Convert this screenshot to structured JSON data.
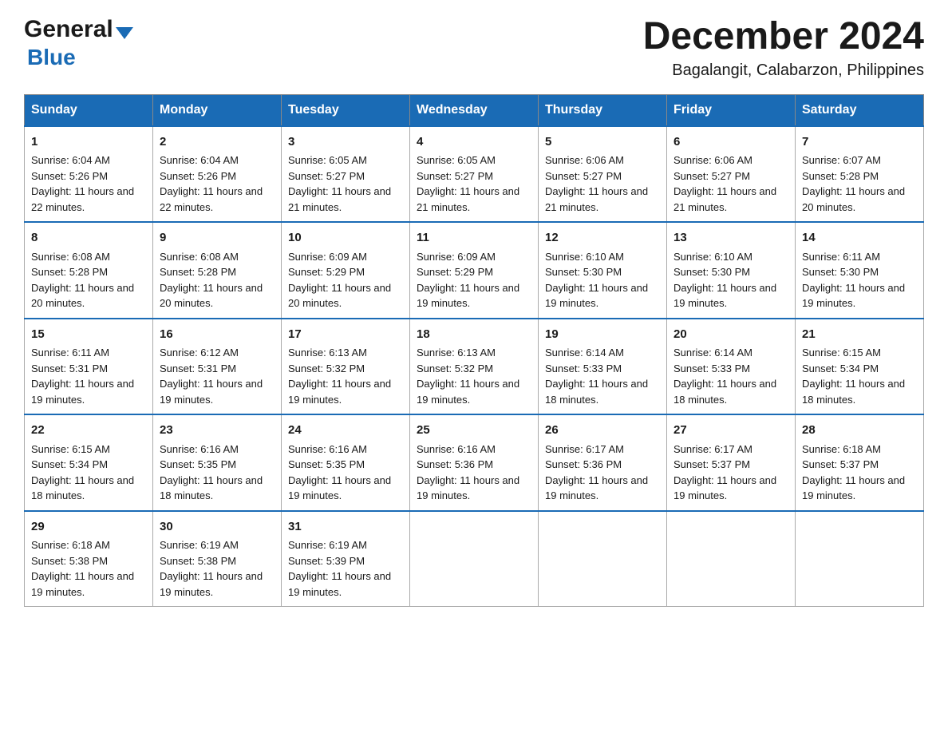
{
  "logo": {
    "general": "General",
    "blue": "Blue",
    "triangle": "▼"
  },
  "title": {
    "month_year": "December 2024",
    "location": "Bagalangit, Calabarzon, Philippines"
  },
  "headers": [
    "Sunday",
    "Monday",
    "Tuesday",
    "Wednesday",
    "Thursday",
    "Friday",
    "Saturday"
  ],
  "weeks": [
    [
      {
        "day": "1",
        "sunrise": "Sunrise: 6:04 AM",
        "sunset": "Sunset: 5:26 PM",
        "daylight": "Daylight: 11 hours and 22 minutes."
      },
      {
        "day": "2",
        "sunrise": "Sunrise: 6:04 AM",
        "sunset": "Sunset: 5:26 PM",
        "daylight": "Daylight: 11 hours and 22 minutes."
      },
      {
        "day": "3",
        "sunrise": "Sunrise: 6:05 AM",
        "sunset": "Sunset: 5:27 PM",
        "daylight": "Daylight: 11 hours and 21 minutes."
      },
      {
        "day": "4",
        "sunrise": "Sunrise: 6:05 AM",
        "sunset": "Sunset: 5:27 PM",
        "daylight": "Daylight: 11 hours and 21 minutes."
      },
      {
        "day": "5",
        "sunrise": "Sunrise: 6:06 AM",
        "sunset": "Sunset: 5:27 PM",
        "daylight": "Daylight: 11 hours and 21 minutes."
      },
      {
        "day": "6",
        "sunrise": "Sunrise: 6:06 AM",
        "sunset": "Sunset: 5:27 PM",
        "daylight": "Daylight: 11 hours and 21 minutes."
      },
      {
        "day": "7",
        "sunrise": "Sunrise: 6:07 AM",
        "sunset": "Sunset: 5:28 PM",
        "daylight": "Daylight: 11 hours and 20 minutes."
      }
    ],
    [
      {
        "day": "8",
        "sunrise": "Sunrise: 6:08 AM",
        "sunset": "Sunset: 5:28 PM",
        "daylight": "Daylight: 11 hours and 20 minutes."
      },
      {
        "day": "9",
        "sunrise": "Sunrise: 6:08 AM",
        "sunset": "Sunset: 5:28 PM",
        "daylight": "Daylight: 11 hours and 20 minutes."
      },
      {
        "day": "10",
        "sunrise": "Sunrise: 6:09 AM",
        "sunset": "Sunset: 5:29 PM",
        "daylight": "Daylight: 11 hours and 20 minutes."
      },
      {
        "day": "11",
        "sunrise": "Sunrise: 6:09 AM",
        "sunset": "Sunset: 5:29 PM",
        "daylight": "Daylight: 11 hours and 19 minutes."
      },
      {
        "day": "12",
        "sunrise": "Sunrise: 6:10 AM",
        "sunset": "Sunset: 5:30 PM",
        "daylight": "Daylight: 11 hours and 19 minutes."
      },
      {
        "day": "13",
        "sunrise": "Sunrise: 6:10 AM",
        "sunset": "Sunset: 5:30 PM",
        "daylight": "Daylight: 11 hours and 19 minutes."
      },
      {
        "day": "14",
        "sunrise": "Sunrise: 6:11 AM",
        "sunset": "Sunset: 5:30 PM",
        "daylight": "Daylight: 11 hours and 19 minutes."
      }
    ],
    [
      {
        "day": "15",
        "sunrise": "Sunrise: 6:11 AM",
        "sunset": "Sunset: 5:31 PM",
        "daylight": "Daylight: 11 hours and 19 minutes."
      },
      {
        "day": "16",
        "sunrise": "Sunrise: 6:12 AM",
        "sunset": "Sunset: 5:31 PM",
        "daylight": "Daylight: 11 hours and 19 minutes."
      },
      {
        "day": "17",
        "sunrise": "Sunrise: 6:13 AM",
        "sunset": "Sunset: 5:32 PM",
        "daylight": "Daylight: 11 hours and 19 minutes."
      },
      {
        "day": "18",
        "sunrise": "Sunrise: 6:13 AM",
        "sunset": "Sunset: 5:32 PM",
        "daylight": "Daylight: 11 hours and 19 minutes."
      },
      {
        "day": "19",
        "sunrise": "Sunrise: 6:14 AM",
        "sunset": "Sunset: 5:33 PM",
        "daylight": "Daylight: 11 hours and 18 minutes."
      },
      {
        "day": "20",
        "sunrise": "Sunrise: 6:14 AM",
        "sunset": "Sunset: 5:33 PM",
        "daylight": "Daylight: 11 hours and 18 minutes."
      },
      {
        "day": "21",
        "sunrise": "Sunrise: 6:15 AM",
        "sunset": "Sunset: 5:34 PM",
        "daylight": "Daylight: 11 hours and 18 minutes."
      }
    ],
    [
      {
        "day": "22",
        "sunrise": "Sunrise: 6:15 AM",
        "sunset": "Sunset: 5:34 PM",
        "daylight": "Daylight: 11 hours and 18 minutes."
      },
      {
        "day": "23",
        "sunrise": "Sunrise: 6:16 AM",
        "sunset": "Sunset: 5:35 PM",
        "daylight": "Daylight: 11 hours and 18 minutes."
      },
      {
        "day": "24",
        "sunrise": "Sunrise: 6:16 AM",
        "sunset": "Sunset: 5:35 PM",
        "daylight": "Daylight: 11 hours and 19 minutes."
      },
      {
        "day": "25",
        "sunrise": "Sunrise: 6:16 AM",
        "sunset": "Sunset: 5:36 PM",
        "daylight": "Daylight: 11 hours and 19 minutes."
      },
      {
        "day": "26",
        "sunrise": "Sunrise: 6:17 AM",
        "sunset": "Sunset: 5:36 PM",
        "daylight": "Daylight: 11 hours and 19 minutes."
      },
      {
        "day": "27",
        "sunrise": "Sunrise: 6:17 AM",
        "sunset": "Sunset: 5:37 PM",
        "daylight": "Daylight: 11 hours and 19 minutes."
      },
      {
        "day": "28",
        "sunrise": "Sunrise: 6:18 AM",
        "sunset": "Sunset: 5:37 PM",
        "daylight": "Daylight: 11 hours and 19 minutes."
      }
    ],
    [
      {
        "day": "29",
        "sunrise": "Sunrise: 6:18 AM",
        "sunset": "Sunset: 5:38 PM",
        "daylight": "Daylight: 11 hours and 19 minutes."
      },
      {
        "day": "30",
        "sunrise": "Sunrise: 6:19 AM",
        "sunset": "Sunset: 5:38 PM",
        "daylight": "Daylight: 11 hours and 19 minutes."
      },
      {
        "day": "31",
        "sunrise": "Sunrise: 6:19 AM",
        "sunset": "Sunset: 5:39 PM",
        "daylight": "Daylight: 11 hours and 19 minutes."
      },
      null,
      null,
      null,
      null
    ]
  ]
}
